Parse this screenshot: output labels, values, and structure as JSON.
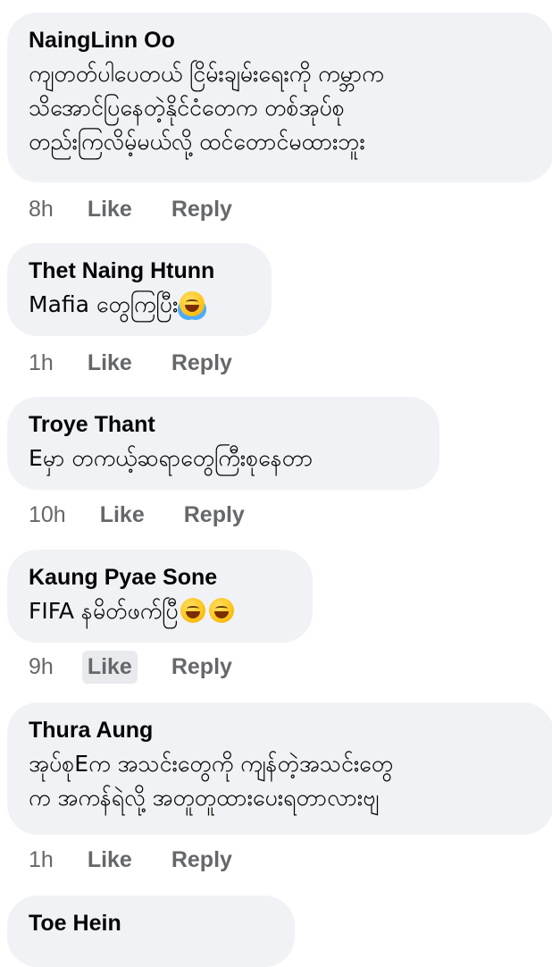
{
  "comments": [
    {
      "author": "NaingLinn Oo",
      "lines": [
        "ကျတတ်ပါပေတယ် ငြိမ်းချမ်းရေးကို ကမ္ဘာက",
        "သိအောင်ပြနေတဲ့နိုင်ငံတေက တစ်အုပ်စု",
        "တည်းကြလိမ့်မယ်လို့ ထင်တောင်မထားဘူး"
      ],
      "time": "8h",
      "like": "Like",
      "reply": "Reply"
    },
    {
      "author": "Thet Naing Htunn",
      "lines": [
        "Mafia တွေကြပြီး"
      ],
      "emoji": [
        "face-with-tears-of-joy-icon"
      ],
      "time": "1h",
      "like": "Like",
      "reply": "Reply"
    },
    {
      "author": "Troye Thant",
      "lines": [
        "Eမှာ တကယ့်ဆရာတွေကြီးစုနေတာ"
      ],
      "time": "10h",
      "like": "Like",
      "reply": "Reply"
    },
    {
      "author": "Kaung Pyae Sone",
      "lines": [
        "FIFA နမိတ်ဖက်ပြီ"
      ],
      "emoji": [
        "grinning-face-icon",
        "grinning-face-icon"
      ],
      "time": "9h",
      "like": "Like",
      "reply": "Reply"
    },
    {
      "author": "Thura Aung",
      "lines": [
        "အုပ်စုEက အသင်းတွေကို ကျန်တဲ့အသင်းတွေ",
        "က အကန်ရဲလို့ အတူတူထားပေးရတာလားဗျ"
      ],
      "time": "1h",
      "like": "Like",
      "reply": "Reply"
    },
    {
      "author": "Toe Hein"
    }
  ]
}
